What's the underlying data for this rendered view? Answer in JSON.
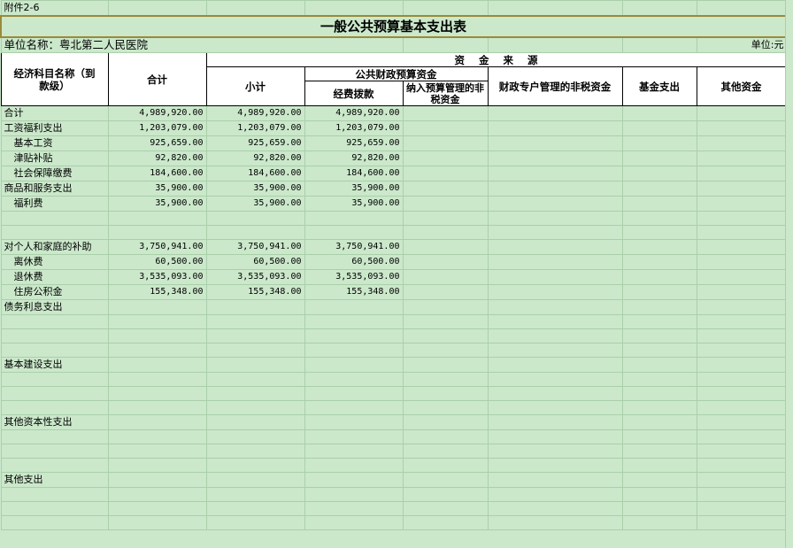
{
  "attachment": "附件2-6",
  "title": "一般公共预算基本支出表",
  "unit_name": "单位名称：粤北第二人民医院",
  "unit": "单位:元",
  "headers": {
    "category": "经济科目名称（到款级）",
    "total": "合计",
    "funding_source": "资    金    来    源",
    "public_budget": "公共财政预算资金",
    "subtotal": "小计",
    "appropriation": "经费拨款",
    "budget_nontax": "纳入预算管理的非税资金",
    "special_nontax": "财政专户管理的非税资金",
    "fund_expense": "基金支出",
    "other_funds": "其他资金"
  },
  "rows": [
    {
      "name": "合计",
      "indent": false,
      "total": "4,989,920.00",
      "subtotal": "4,989,920.00",
      "appropriation": "4,989,920.00"
    },
    {
      "name": "工资福利支出",
      "indent": false,
      "total": "1,203,079.00",
      "subtotal": "1,203,079.00",
      "appropriation": "1,203,079.00"
    },
    {
      "name": "基本工资",
      "indent": true,
      "total": "925,659.00",
      "subtotal": "925,659.00",
      "appropriation": "925,659.00"
    },
    {
      "name": "津贴补贴",
      "indent": true,
      "total": "92,820.00",
      "subtotal": "92,820.00",
      "appropriation": "92,820.00"
    },
    {
      "name": "社会保障缴费",
      "indent": true,
      "total": "184,600.00",
      "subtotal": "184,600.00",
      "appropriation": "184,600.00"
    },
    {
      "name": "商品和服务支出",
      "indent": false,
      "total": "35,900.00",
      "subtotal": "35,900.00",
      "appropriation": "35,900.00"
    },
    {
      "name": "福利费",
      "indent": true,
      "total": "35,900.00",
      "subtotal": "35,900.00",
      "appropriation": "35,900.00"
    },
    {
      "name": "",
      "indent": false,
      "total": "",
      "subtotal": "",
      "appropriation": ""
    },
    {
      "name": "",
      "indent": false,
      "total": "",
      "subtotal": "",
      "appropriation": ""
    },
    {
      "name": "对个人和家庭的补助",
      "indent": false,
      "total": "3,750,941.00",
      "subtotal": "3,750,941.00",
      "appropriation": "3,750,941.00"
    },
    {
      "name": "离休费",
      "indent": true,
      "total": "60,500.00",
      "subtotal": "60,500.00",
      "appropriation": "60,500.00"
    },
    {
      "name": "退休费",
      "indent": true,
      "total": "3,535,093.00",
      "subtotal": "3,535,093.00",
      "appropriation": "3,535,093.00"
    },
    {
      "name": "住房公积金",
      "indent": true,
      "total": "155,348.00",
      "subtotal": "155,348.00",
      "appropriation": "155,348.00"
    },
    {
      "name": "债务利息支出",
      "indent": false,
      "total": "",
      "subtotal": "",
      "appropriation": ""
    },
    {
      "name": "",
      "indent": false,
      "total": "",
      "subtotal": "",
      "appropriation": ""
    },
    {
      "name": "",
      "indent": false,
      "total": "",
      "subtotal": "",
      "appropriation": ""
    },
    {
      "name": "",
      "indent": false,
      "total": "",
      "subtotal": "",
      "appropriation": ""
    },
    {
      "name": "基本建设支出",
      "indent": false,
      "total": "",
      "subtotal": "",
      "appropriation": ""
    },
    {
      "name": "",
      "indent": false,
      "total": "",
      "subtotal": "",
      "appropriation": ""
    },
    {
      "name": "",
      "indent": false,
      "total": "",
      "subtotal": "",
      "appropriation": ""
    },
    {
      "name": "",
      "indent": false,
      "total": "",
      "subtotal": "",
      "appropriation": ""
    },
    {
      "name": "其他资本性支出",
      "indent": false,
      "total": "",
      "subtotal": "",
      "appropriation": ""
    },
    {
      "name": "",
      "indent": false,
      "total": "",
      "subtotal": "",
      "appropriation": ""
    },
    {
      "name": "",
      "indent": false,
      "total": "",
      "subtotal": "",
      "appropriation": ""
    },
    {
      "name": "",
      "indent": false,
      "total": "",
      "subtotal": "",
      "appropriation": ""
    },
    {
      "name": "其他支出",
      "indent": false,
      "total": "",
      "subtotal": "",
      "appropriation": ""
    },
    {
      "name": "",
      "indent": false,
      "total": "",
      "subtotal": "",
      "appropriation": ""
    },
    {
      "name": "",
      "indent": false,
      "total": "",
      "subtotal": "",
      "appropriation": ""
    },
    {
      "name": "",
      "indent": false,
      "total": "",
      "subtotal": "",
      "appropriation": ""
    }
  ],
  "colors": {
    "sheet_background": "#cbe8cb",
    "header_background": "#ffffff",
    "gridline": "#aacfaa",
    "title_border": "#9a8a3a"
  }
}
